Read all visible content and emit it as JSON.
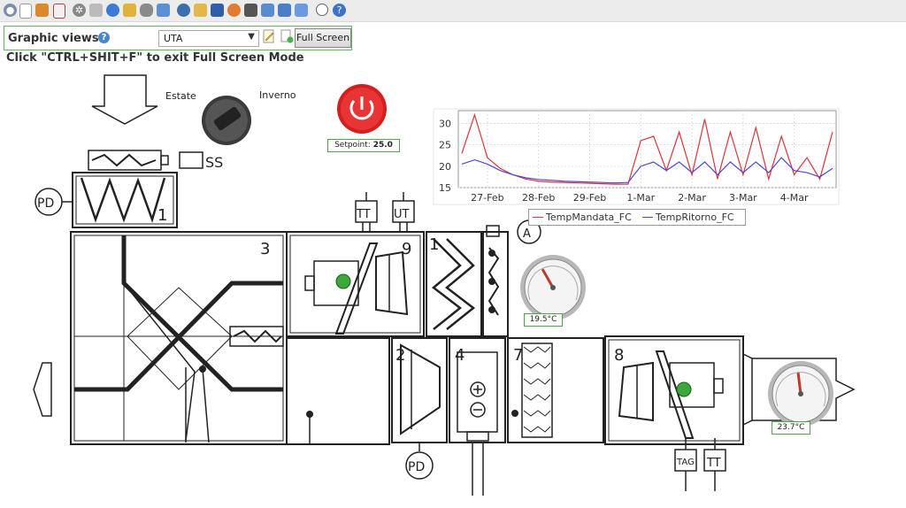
{
  "toolbar": {
    "icons": [
      "view-icon",
      "document-icon",
      "edit-icon",
      "list-icon",
      "settings-icon",
      "database-icon",
      "clock-icon",
      "pencil-icon",
      "link-icon",
      "report-icon",
      "user-icon",
      "folder-icon",
      "calculator-icon",
      "chart-icon",
      "tools-icon",
      "table-icon",
      "export-icon",
      "page-icon",
      "record-icon",
      "help-icon"
    ]
  },
  "graphic_views": {
    "label": "Graphic views",
    "help": "?",
    "selected": "UTA",
    "fullscreen_label": "Full Screen"
  },
  "hint": "Click \"CTRL+SHIT+F\" to exit Full Screen Mode",
  "scada": {
    "season_summer": "Estate",
    "season_winter": "Inverno",
    "setpoint_label": "Setpoint:",
    "setpoint_value": "25.0",
    "gauge1_value": "19.5°C",
    "gauge1_level": 19.5,
    "gauge2_value": "23.7°C",
    "gauge2_level": 23.7,
    "tags": {
      "ss": "SS",
      "pd": "PD",
      "tt": "TT",
      "ut": "UT",
      "tag": "TAG",
      "a": "A",
      "n1": "1",
      "n2": "2",
      "n3": "3",
      "n4": "4",
      "n7": "7",
      "n8": "8",
      "n9": "9"
    }
  },
  "chart_data": {
    "type": "line",
    "ylim": [
      15,
      33
    ],
    "yticks": [
      "15",
      "20",
      "25",
      "30"
    ],
    "xticks": [
      "27-Feb",
      "28-Feb",
      "29-Feb",
      "1-Mar",
      "2-Mar",
      "3-Mar",
      "4-Mar"
    ],
    "x": [
      "26-Feb 12:00",
      "26-Feb 18:00",
      "27-Feb 00:00",
      "27-Feb 06:00",
      "27-Feb 12:00",
      "27-Feb 18:00",
      "28-Feb 00:00",
      "28-Feb 06:00",
      "28-Feb 12:00",
      "28-Feb 18:00",
      "29-Feb 00:00",
      "29-Feb 06:00",
      "29-Feb 12:00",
      "29-Feb 18:00",
      "1-Mar 00:00",
      "1-Mar 06:00",
      "1-Mar 12:00",
      "1-Mar 18:00",
      "2-Mar 00:00",
      "2-Mar 06:00",
      "2-Mar 12:00",
      "2-Mar 18:00",
      "3-Mar 00:00",
      "3-Mar 06:00",
      "3-Mar 12:00",
      "3-Mar 18:00",
      "4-Mar 00:00",
      "4-Mar 06:00",
      "4-Mar 12:00",
      "4-Mar 18:00"
    ],
    "series": [
      {
        "name": "TempMandata_FC",
        "color": "#e0323a",
        "values": [
          23,
          32,
          22,
          19.5,
          18,
          17,
          16.5,
          16.3,
          16.2,
          16.1,
          16,
          15.9,
          15.8,
          15.8,
          26,
          27,
          19,
          28,
          18,
          31,
          17,
          28,
          18,
          29,
          17,
          27,
          18,
          22,
          17,
          28
        ]
      },
      {
        "name": "TempRitorno_FC",
        "color": "#4a4ad0",
        "values": [
          20.5,
          21.5,
          20.5,
          19,
          18,
          17.3,
          16.9,
          16.7,
          16.5,
          16.4,
          16.3,
          16.2,
          16.1,
          16.2,
          20,
          21,
          19,
          21,
          18.5,
          21,
          18,
          21,
          18.5,
          21,
          18.5,
          22,
          19,
          18.5,
          17.5,
          19.5
        ]
      }
    ]
  }
}
